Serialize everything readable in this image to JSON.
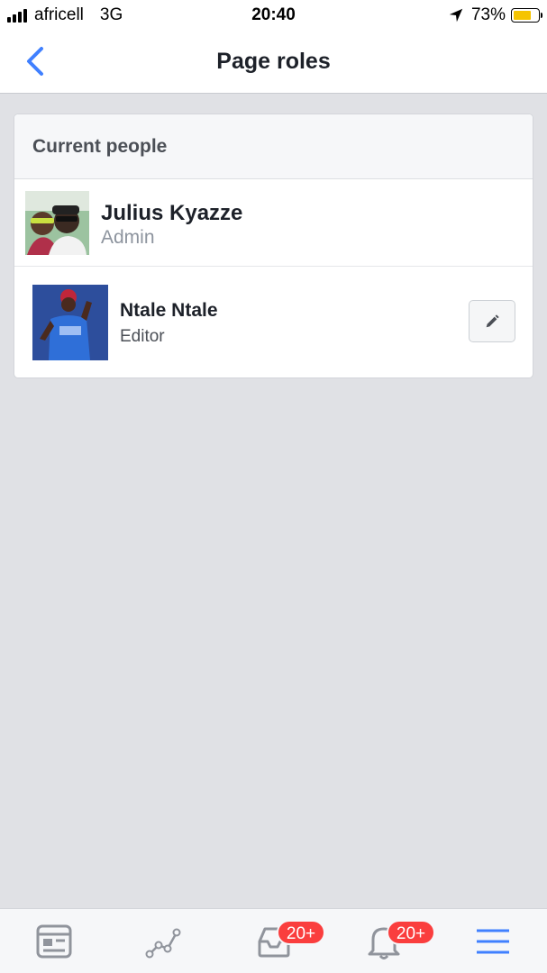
{
  "status_bar": {
    "carrier": "africell",
    "network": "3G",
    "time": "20:40",
    "battery_percent": "73%",
    "battery_level": 0.73,
    "battery_color": "#f5c400"
  },
  "nav": {
    "title": "Page roles",
    "back_icon": "chevron-left-icon",
    "accent_color": "#4080ff"
  },
  "section": {
    "header": "Current people"
  },
  "people": [
    {
      "name": "Julius Kyazze",
      "role": "Admin",
      "editable": false
    },
    {
      "name": "Ntale Ntale",
      "role": "Editor",
      "editable": true,
      "edit_icon": "pencil-icon"
    }
  ],
  "tab_bar": {
    "tabs": [
      {
        "name": "feed",
        "icon": "feed-icon"
      },
      {
        "name": "insights",
        "icon": "insights-icon"
      },
      {
        "name": "inbox",
        "icon": "inbox-icon",
        "badge": "20+"
      },
      {
        "name": "notifications",
        "icon": "bell-icon",
        "badge": "20+"
      },
      {
        "name": "menu",
        "icon": "menu-icon"
      }
    ],
    "badge_color": "#fa3e3e",
    "active_color": "#4080ff"
  }
}
